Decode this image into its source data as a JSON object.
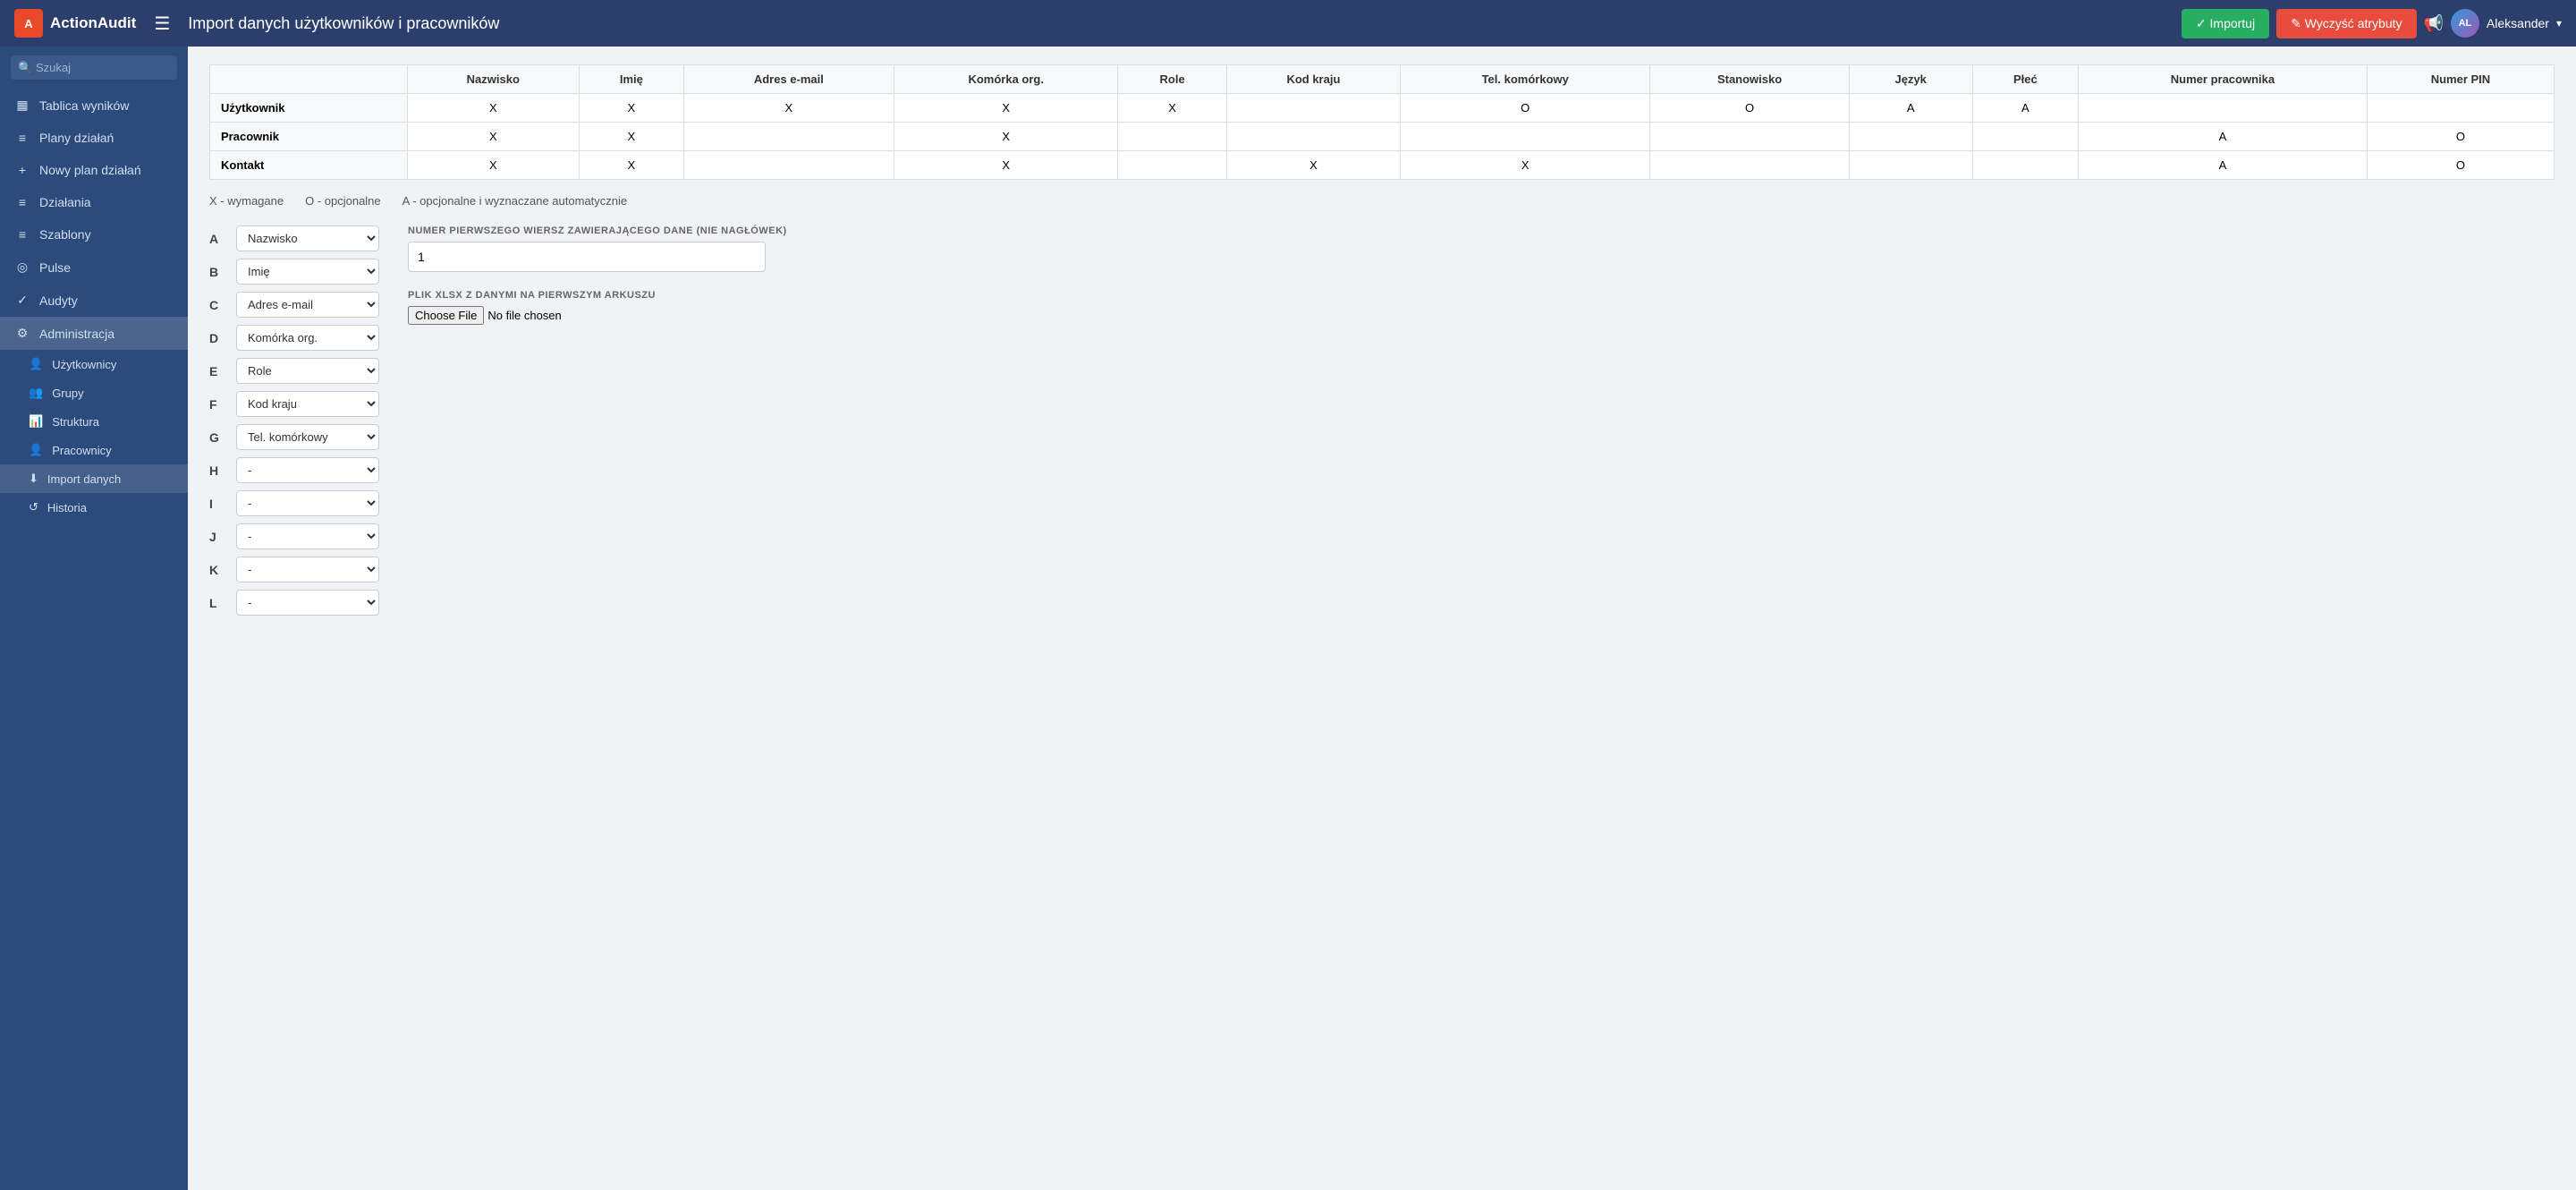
{
  "header": {
    "logo_text": "ActionAudit",
    "logo_abbr": "A",
    "page_title": "Import danych użytkowników i pracowników",
    "import_btn": "✓ Importuj",
    "clear_btn": "✎ Wyczyść atrybuty",
    "user_name": "Aleksander",
    "notification_symbol": "📢"
  },
  "sidebar": {
    "search_placeholder": "Szukaj",
    "items": [
      {
        "id": "tablica",
        "label": "Tablica wyników",
        "icon": "▦"
      },
      {
        "id": "plany",
        "label": "Plany działań",
        "icon": "≡"
      },
      {
        "id": "nowy-plan",
        "label": "Nowy plan działań",
        "icon": "+"
      },
      {
        "id": "dzialania",
        "label": "Działania",
        "icon": "≡"
      },
      {
        "id": "szablony",
        "label": "Szablony",
        "icon": "≡"
      },
      {
        "id": "pulse",
        "label": "Pulse",
        "icon": "◎"
      },
      {
        "id": "audyty",
        "label": "Audyty",
        "icon": "✓"
      },
      {
        "id": "administracja",
        "label": "Administracja",
        "icon": "⚙"
      }
    ],
    "sub_items": [
      {
        "id": "uzytkownicy",
        "label": "Użytkownicy",
        "icon": "👤"
      },
      {
        "id": "grupy",
        "label": "Grupy",
        "icon": "👥"
      },
      {
        "id": "struktura",
        "label": "Struktura",
        "icon": "📊"
      },
      {
        "id": "pracownicy",
        "label": "Pracownicy",
        "icon": "👤"
      },
      {
        "id": "import",
        "label": "Import danych",
        "icon": "⬇"
      },
      {
        "id": "historia",
        "label": "Historia",
        "icon": "↺"
      }
    ]
  },
  "table": {
    "headers": [
      "",
      "Nazwisko",
      "Imię",
      "Adres e-mail",
      "Komórka org.",
      "Role",
      "Kod kraju",
      "Tel. komórkowy",
      "Stanowisko",
      "Język",
      "Płeć",
      "Numer pracownika",
      "Numer PIN"
    ],
    "rows": [
      {
        "label": "Użytkownik",
        "values": [
          "X",
          "X",
          "X",
          "X",
          "X",
          "",
          "O",
          "O",
          "A",
          "A",
          "",
          ""
        ]
      },
      {
        "label": "Pracownik",
        "values": [
          "X",
          "X",
          "",
          "X",
          "",
          "",
          "",
          "",
          "",
          "",
          "A",
          "O"
        ]
      },
      {
        "label": "Kontakt",
        "values": [
          "X",
          "X",
          "",
          "X",
          "",
          "X",
          "X",
          "",
          "",
          "",
          "A",
          "O"
        ]
      }
    ]
  },
  "legend": {
    "x_text": "X - wymagane",
    "o_text": "O - opcjonalne",
    "a_text": "A - opcjonalne i wyznaczane automatycznie"
  },
  "column_map": {
    "label": "NUMER PIERWSZEGO WIERSZ ZAWIERAJĄCEGO DANE (NIE NAGŁÓWEK)",
    "file_label": "PLIK XLSX Z DANYMI NA PIERWSZYM ARKUSZU",
    "row_number_value": "1",
    "row_number_placeholder": "1",
    "file_choose_label": "Choose file",
    "file_no_file": "No file chosen",
    "columns": [
      {
        "letter": "A",
        "value": "Nazwisko"
      },
      {
        "letter": "B",
        "value": "Imię"
      },
      {
        "letter": "C",
        "value": "Adres e-mail"
      },
      {
        "letter": "D",
        "value": "Komórka org."
      },
      {
        "letter": "E",
        "value": "Role"
      },
      {
        "letter": "F",
        "value": "Kod kraju"
      },
      {
        "letter": "G",
        "value": "Tel. komórkowy"
      },
      {
        "letter": "H",
        "value": ""
      },
      {
        "letter": "I",
        "value": ""
      },
      {
        "letter": "J",
        "value": ""
      },
      {
        "letter": "K",
        "value": ""
      },
      {
        "letter": "L",
        "value": ""
      }
    ],
    "select_options": [
      "",
      "Nazwisko",
      "Imię",
      "Adres e-mail",
      "Komórka org.",
      "Role",
      "Kod kraju",
      "Tel. komórkowy",
      "Stanowisko",
      "Język",
      "Płeć",
      "Numer pracownika",
      "Numer PIN"
    ]
  }
}
